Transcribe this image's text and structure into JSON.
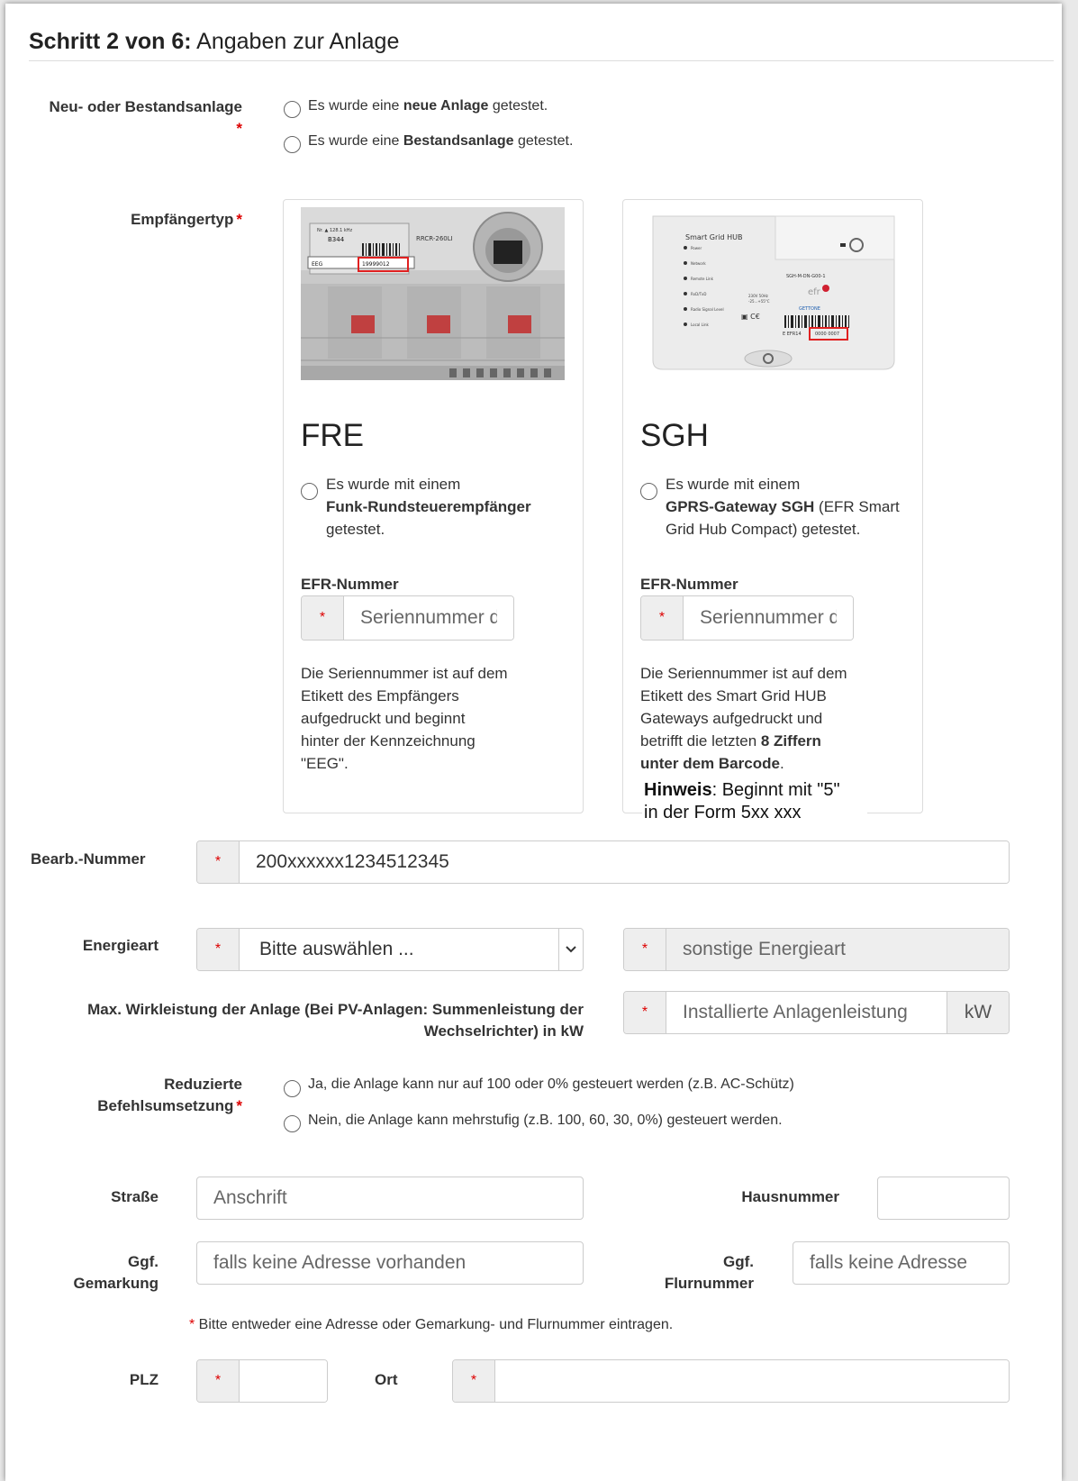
{
  "step": {
    "prefix": "Schritt 2 von 6:",
    "title": "Angaben zur Anlage"
  },
  "neu_bestand": {
    "label": "Neu- oder Bestandsanlage",
    "req": "*",
    "options": [
      {
        "pre": "Es wurde eine ",
        "bold": "neue Anlage",
        "post": " getestet."
      },
      {
        "pre": "Es wurde eine ",
        "bold": "Bestandsanlage",
        "post": " getestet."
      }
    ]
  },
  "empfaenger": {
    "label": "Empfängertyp",
    "req": "*",
    "cards": [
      {
        "title": "FRE",
        "radio_line1": "Es wurde mit einem",
        "radio_bold": "Funk-Rundsteuerempfänger",
        "radio_line3": "getestet.",
        "efr_label": "EFR-Nummer",
        "efr_req": "*",
        "efr_placeholder": "Seriennummer d",
        "desc_lines": [
          "Die Seriennummer ist auf dem",
          "Etikett des Empfängers",
          "aufgedruckt und beginnt",
          "hinter der Kennzeichnung",
          "\"EEG\"."
        ],
        "image": {
          "label_top": "Nr. ▲ 128.1 kHz",
          "label_num": "B344",
          "model": "RRCR-260LI",
          "eeg": "EEG",
          "serial": "19999012"
        }
      },
      {
        "title": "SGH",
        "radio_line1": "Es wurde mit einem",
        "radio_bold": "GPRS-Gateway SGH",
        "radio_after_bold": " (EFR Smart",
        "radio_line3": "Grid Hub Compact) getestet.",
        "efr_label": "EFR-Nummer",
        "efr_req": "*",
        "efr_placeholder": "Seriennummer d",
        "desc_lines": [
          "Die Seriennummer ist auf dem",
          "Etikett des Smart Grid HUB",
          "Gateways aufgedruckt und",
          "betrifft die letzten "
        ],
        "desc_bold_1": "8 Ziffern",
        "desc_bold_2": "unter dem Barcode",
        "desc_end": ".",
        "hint_bold": "Hinweis",
        "hint_line1": ": Beginnt mit \"5\"",
        "hint_line2": "in der Form 5xx xxx",
        "image": {
          "device_title": "Smart Grid HUB",
          "leds": [
            "Power",
            "Network",
            "Remote Link",
            "RxD/TxD",
            "Radio Signal Level",
            "Local Link"
          ],
          "model_code": "SGH-M-DN-G00-1",
          "brand1": "efr",
          "brand2": "GETTONE",
          "spec1": "230V 50Hz",
          "spec2": "-25...+55°C",
          "barcode_pre": "E EFR14",
          "barcode_serial": "0000 0007"
        }
      }
    ]
  },
  "bearb": {
    "label": "Bearb.-Nummer",
    "req": "*",
    "value": "200xxxxxx1234512345"
  },
  "energie": {
    "label": "Energieart",
    "req": "*",
    "select_value": "Bitte auswählen ...",
    "other_req": "*",
    "other_placeholder": "sonstige Energieart"
  },
  "leistung": {
    "label_line1": "Max. Wirkleistung der Anlage (Bei PV-Anlagen: Summenleistung der",
    "label_line2": "Wechselrichter) in kW",
    "req": "*",
    "placeholder": "Installierte Anlagenleistung",
    "unit": "kW"
  },
  "reduziert": {
    "label_line1": "Reduzierte",
    "label_line2": "Befehlsumsetzung",
    "req": "*",
    "options": [
      "Ja, die Anlage kann nur auf 100 oder 0% gesteuert werden (z.B. AC-Schütz)",
      "Nein, die Anlage kann mehrstufig (z.B. 100, 60, 30, 0%) gesteuert werden."
    ]
  },
  "strasse": {
    "label": "Straße",
    "placeholder": "Anschrift"
  },
  "hausnummer": {
    "label": "Hausnummer"
  },
  "gemarkung": {
    "label_line1": "Ggf.",
    "label_line2": "Gemarkung",
    "placeholder": "falls keine Adresse vorhanden"
  },
  "flurnummer": {
    "label_line1": "Ggf.",
    "label_line2": "Flurnummer",
    "placeholder": "falls keine Adresse"
  },
  "adress_note": {
    "star": "*",
    "text": " Bitte entweder eine Adresse oder Gemarkung- und Flurnummer eintragen."
  },
  "plz": {
    "label": "PLZ",
    "req": "*"
  },
  "ort": {
    "label": "Ort",
    "req": "*"
  }
}
